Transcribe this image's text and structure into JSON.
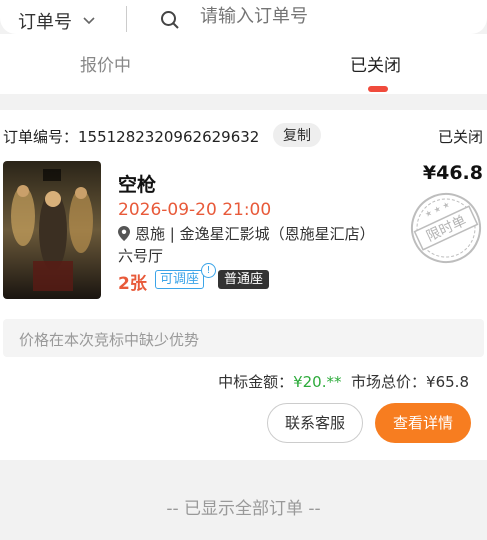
{
  "search": {
    "filter_label": "订单号",
    "placeholder": "请输入订单号"
  },
  "tabs": [
    {
      "label": "报价中",
      "active": false
    },
    {
      "label": "已关闭",
      "active": true
    }
  ],
  "order": {
    "order_no_text": "订单编号：1551282320962629632",
    "copy_label": "复制",
    "status": "已关闭",
    "movie_title": "空枪",
    "price": "¥46.8",
    "showtime": "2026-09-20 21:00",
    "cinema": "恩施 | 金逸星汇影城（恩施星汇店）",
    "hall": "六号厅",
    "seat_count": "2张",
    "adjustable_label": "可调座",
    "seat_type": "普通座",
    "stamp_text": "限时单",
    "hint": "价格在本次竞标中缺少优势",
    "win_amount_label": "中标金额：",
    "win_amount": "¥20.**",
    "market_total_label": "市场总价：",
    "market_total": "¥65.8",
    "contact_label": "联系客服",
    "detail_label": "查看详情"
  },
  "footer": {
    "end_text": "-- 已显示全部订单 --"
  },
  "colors": {
    "accent_red": "#f04b3c",
    "orange_button": "#f77d20",
    "win_green": "#2dab3b",
    "link_blue": "#3ba4e8"
  }
}
